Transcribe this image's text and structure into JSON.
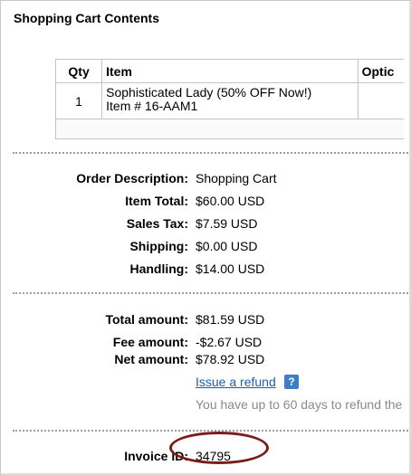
{
  "section_title": "Shopping Cart Contents",
  "cart_table": {
    "headers": {
      "qty": "Qty",
      "item": "Item",
      "options": "Optic"
    },
    "rows": [
      {
        "qty": "1",
        "name": "Sophisticated Lady (50% OFF Now!)",
        "item_number": "Item # 16-AAM1"
      }
    ]
  },
  "summary": {
    "order_description": {
      "label": "Order Description:",
      "value": "Shopping Cart"
    },
    "item_total": {
      "label": "Item Total:",
      "value": "$60.00 USD"
    },
    "sales_tax": {
      "label": "Sales Tax:",
      "value": "$7.59 USD"
    },
    "shipping": {
      "label": "Shipping:",
      "value": "$0.00 USD"
    },
    "handling": {
      "label": "Handling:",
      "value": "$14.00 USD"
    }
  },
  "totals": {
    "total_amount": {
      "label": "Total amount:",
      "value": "$81.59 USD"
    },
    "fee_amount": {
      "label": "Fee amount:",
      "value": "-$2.67 USD"
    },
    "net_amount": {
      "label": "Net amount:",
      "value": "$78.92 USD"
    }
  },
  "refund": {
    "link_label": "Issue a refund",
    "help_icon": "?",
    "note": "You have up to 60 days to refund the"
  },
  "invoice": {
    "label": "Invoice ID:",
    "value": "34795"
  },
  "colors": {
    "link": "#1a5fa8",
    "help_icon_bg": "#3d7ec6",
    "annotation": "#7a1c1c",
    "note_text": "#8a8a8a"
  }
}
